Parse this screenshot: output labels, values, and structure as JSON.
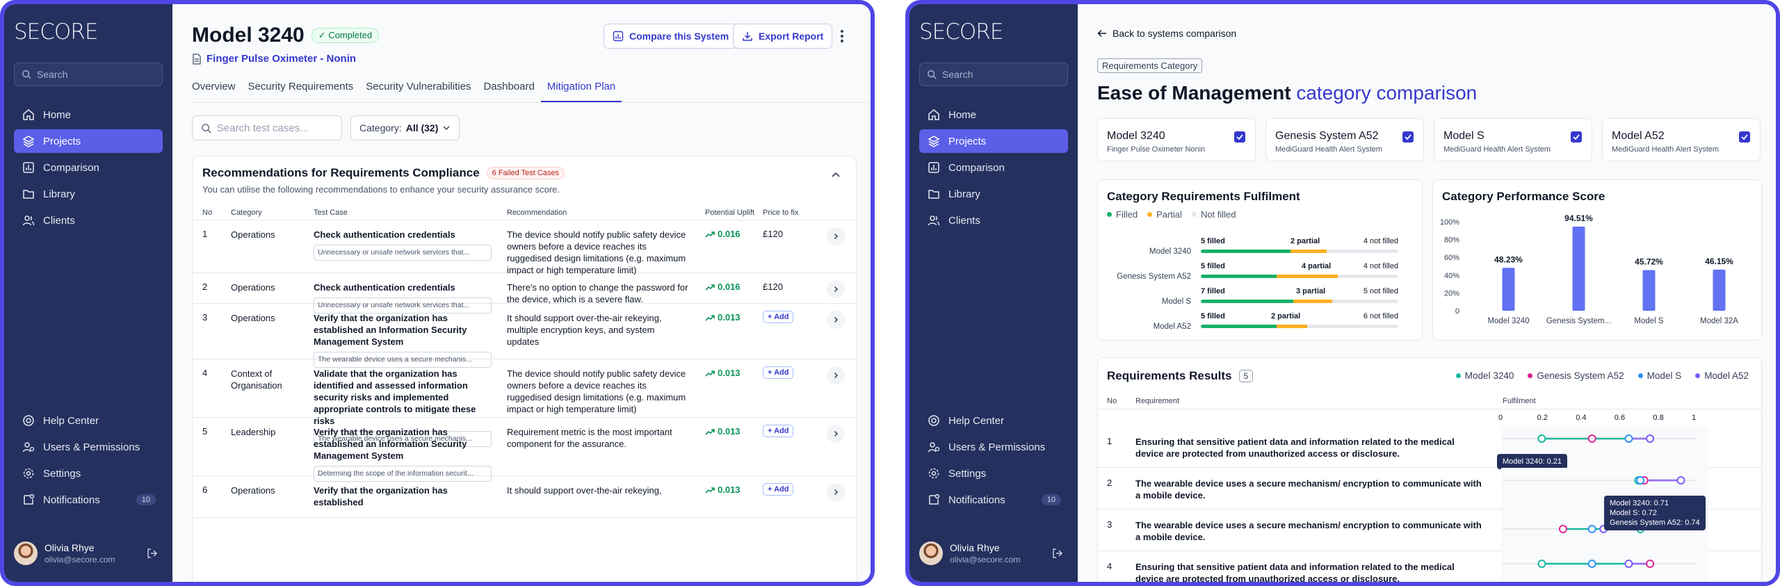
{
  "logo": "SECORE",
  "sidebar": {
    "search_placeholder": "Search",
    "nav": [
      {
        "label": "Home",
        "icon": "home-icon"
      },
      {
        "label": "Projects",
        "icon": "layers-icon",
        "active": true
      },
      {
        "label": "Comparison",
        "icon": "bar-chart-icon"
      },
      {
        "label": "Library",
        "icon": "folder-icon"
      },
      {
        "label": "Clients",
        "icon": "users-icon"
      }
    ],
    "bottom_nav": [
      {
        "label": "Help Center",
        "icon": "lifebuoy-icon"
      },
      {
        "label": "Users & Permissions",
        "icon": "users-permissions-icon"
      },
      {
        "label": "Settings",
        "icon": "gear-icon"
      },
      {
        "label": "Notifications",
        "icon": "bell-icon",
        "badge": "10"
      }
    ],
    "user": {
      "name": "Olivia Rhye",
      "email": "olivia@secore.com"
    }
  },
  "screen_a": {
    "title": "Model 3240",
    "status": "✓ Completed",
    "subtitle": "Finger Pulse Oximeter - Nonin",
    "compare_button": "Compare this System",
    "export_button": "Export Report",
    "tabs": [
      "Overview",
      "Security Requirements",
      "Security Vulnerabilities",
      "Dashboard",
      "Mitigation Plan"
    ],
    "active_tab": "Mitigation Plan",
    "search_placeholder": "Search test cases...",
    "category_label": "Category:",
    "category_value": "All (32)",
    "card": {
      "title": "Recommendations for Requirements Compliance",
      "badge": "6 Failed Test Cases",
      "description": "You can utilise the following recommendations to enhance your security assurance score.",
      "columns": [
        "No",
        "Category",
        "Test Case",
        "Recommendation",
        "Potential Uplift",
        "Price to fix"
      ],
      "rows": [
        {
          "no": "1",
          "category": "Operations",
          "test_case": "Check authentication credentials",
          "chip": "Unnecessary or unsafe network services that...",
          "recommendation": "The device should notify public safety device owners before a device reaches its ruggedised design limitations (e.g. maximum impact or high temperature limit)",
          "uplift": "0.016",
          "price": "£120"
        },
        {
          "no": "2",
          "category": "Operations",
          "test_case": "Check authentication credentials",
          "chip": "Unnecessary or unsafe network services that...",
          "recommendation": "There's no option to change the password for the device, which is a severe flaw.",
          "uplift": "0.016",
          "price": "£120"
        },
        {
          "no": "3",
          "category": "Operations",
          "test_case": "Verify that the organization has established an Information Security Management System",
          "chip": "The wearable device uses a secure mechanis...",
          "recommendation": "It should support over-the-air rekeying, multiple encryption keys, and system updates",
          "uplift": "0.013",
          "price": "+ Add"
        },
        {
          "no": "4",
          "category": "Context of Organisation",
          "test_case": "Validate that the organization has identified and assessed information security risks and implemented appropriate controls to mitigate these risks",
          "chip": "The wearable device uses a secure mechanis...",
          "recommendation": "The device should notify public safety device owners before a device reaches its ruggedised design limitations (e.g. maximum impact or high temperature limit)",
          "uplift": "0.013",
          "price": "+ Add"
        },
        {
          "no": "5",
          "category": "Leadership",
          "test_case": "Verify that the organization has established an Information Security Management System",
          "chip": "Determing the scope of the information securit...",
          "recommendation": "Requirement metric is the most important component for the assurance.",
          "uplift": "0.013",
          "price": "+ Add"
        },
        {
          "no": "6",
          "category": "Operations",
          "test_case": "Verify that the organization has established",
          "chip": "",
          "recommendation": "It should support over-the-air rekeying,",
          "uplift": "0.013",
          "price": "+ Add"
        }
      ]
    }
  },
  "screen_b": {
    "back_link": "Back to systems comparison",
    "tag": "Requirements Category",
    "title_main": "Ease of Management",
    "title_accent": "category comparison",
    "models": [
      {
        "name": "Model 3240",
        "sub": "Finger Pulse Oximeter Nonin"
      },
      {
        "name": "Genesis System A52",
        "sub": "MediGuard Health Alert System"
      },
      {
        "name": "Model S",
        "sub": "MediGuard Health Alert System"
      },
      {
        "name": "Model A52",
        "sub": "MediGuard Health Alert System"
      }
    ],
    "fulfilment": {
      "title": "Category Requirements Fulfilment",
      "legend": [
        "Filled",
        "Partial",
        "Not filled"
      ],
      "colors": {
        "filled": "#17b26a",
        "partial": "#f79009",
        "not_filled": "#e4e7ec"
      },
      "rows": [
        {
          "label": "Model 3240",
          "filled": 5,
          "partial": 2,
          "not_filled": 4,
          "filled_text": "5 filled",
          "partial_text": "2 partial",
          "not_text": "4 not filled"
        },
        {
          "label": "Genesis System A52",
          "filled": 5,
          "partial": 4,
          "not_filled": 4,
          "filled_text": "5 filled",
          "partial_text": "4 partial",
          "not_text": "4 not filled"
        },
        {
          "label": "Model S",
          "filled": 7,
          "partial": 3,
          "not_filled": 5,
          "filled_text": "7 filled",
          "partial_text": "3 partial",
          "not_text": "5 not filled"
        },
        {
          "label": "Model A52",
          "filled": 5,
          "partial": 2,
          "not_filled": 6,
          "filled_text": "5 filled",
          "partial_text": "2 partial",
          "not_text": "6 not filled"
        }
      ]
    },
    "results": {
      "title": "Requirements Results",
      "count": "5",
      "legend": [
        {
          "name": "Model 3240",
          "color": "#15b79e"
        },
        {
          "name": "Genesis System A52",
          "color": "#dd2590"
        },
        {
          "name": "Model S",
          "color": "#2e90fa"
        },
        {
          "name": "Model A52",
          "color": "#7a5af8"
        }
      ],
      "columns": [
        "No",
        "Requirement",
        "Fulfilment"
      ],
      "ticks": [
        "0",
        "0.2",
        "0.4",
        "0.6",
        "0.8",
        "1"
      ],
      "rows": [
        {
          "no": "1",
          "text": "Ensuring that sensitive patient data and information related to the medical device are protected from unauthorized access or disclosure.",
          "values": [
            0.21,
            0.47,
            0.66,
            0.77
          ],
          "tooltip": [
            "Model 3240: 0.21"
          ]
        },
        {
          "no": "2",
          "text": "The wearable device uses a secure mechanism/ encryption to communicate with a mobile device.",
          "values": [
            0.71,
            0.74,
            0.72,
            0.93
          ],
          "tooltip": [
            "Model 3240: 0.71",
            "Model S: 0.72",
            "Genesis System A52: 0.74"
          ]
        },
        {
          "no": "3",
          "text": "The wearable device uses a secure mechanism/ encryption to communicate with a mobile device.",
          "values": [
            0.72,
            0.32,
            0.47,
            0.53
          ],
          "tooltip": []
        },
        {
          "no": "4",
          "text": "Ensuring that sensitive patient data and information related to the medical device are protected from unauthorized access or disclosure.",
          "values": [
            0.21,
            0.77,
            0.47,
            0.66
          ],
          "tooltip": []
        }
      ]
    },
    "chart_data": {
      "type": "bar",
      "title": "Category Performance Score",
      "categories": [
        "Model 3240",
        "Genesis System...",
        "Model S",
        "Model 32A"
      ],
      "values": [
        48.23,
        94.51,
        45.72,
        46.15
      ],
      "labels": [
        "48.23%",
        "94.51%",
        "45.72%",
        "46.15%"
      ],
      "ylim": [
        0,
        100
      ],
      "yticks": [
        "0",
        "20%",
        "40%",
        "60%",
        "80%",
        "100%"
      ],
      "bar_color": "#6172f3"
    }
  }
}
